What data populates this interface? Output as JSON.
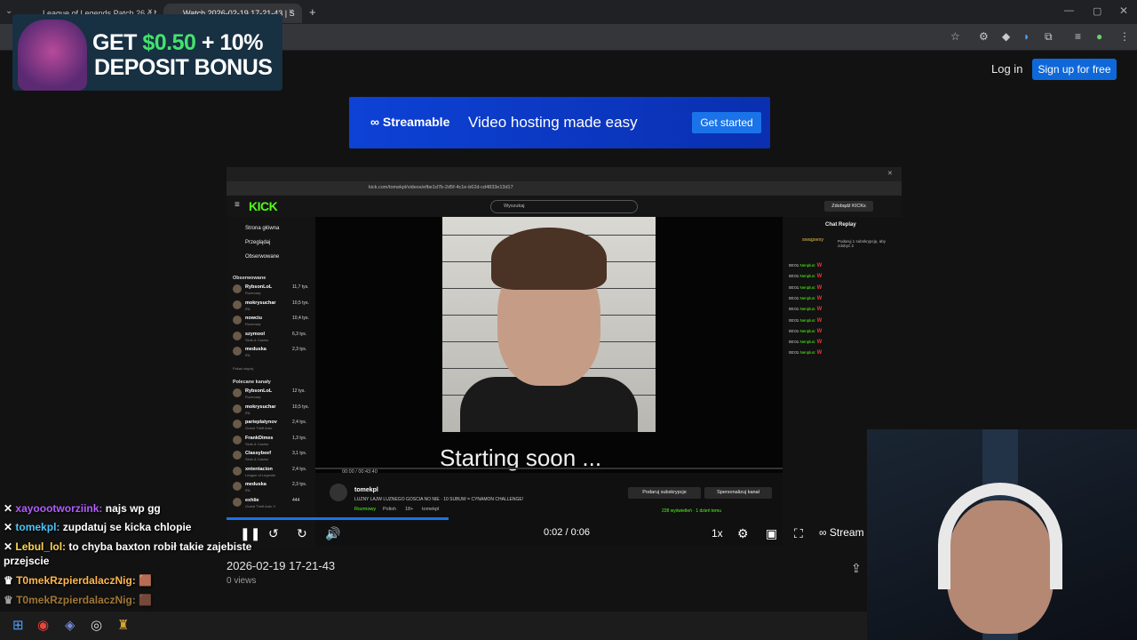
{
  "browser": {
    "tabs": [
      {
        "title": "League of Legends Patch 26.4 N",
        "active": false
      },
      {
        "title": "Watch 2026-02-19 17-21-43 | S",
        "active": true
      }
    ],
    "new_tab": "+",
    "tab_close": "×"
  },
  "ad": {
    "line1_prefix": "GET ",
    "line1_amount": "$0.50",
    "line1_suffix": " + 10%",
    "line2": "DEPOSIT BONUS"
  },
  "header": {
    "login": "Log in",
    "signup": "Sign up for free"
  },
  "promo": {
    "logo": "Streamable",
    "tagline": "Video hosting made easy",
    "cta": "Get started"
  },
  "video_frame": {
    "inner_url": "kick.com/tomekpl/videos/efbe1d7b-2d5f-4c1e-b62d-cd4833e13d17",
    "kick_logo": "KICK",
    "search_placeholder": "Wyszukaj",
    "get_kicks": "Zdobądź KICKs",
    "nav": [
      "Strona główna",
      "Przeglądaj",
      "Obserwowane"
    ],
    "followed_title": "Obserwowane",
    "followed": [
      {
        "name": "RybsonLoL",
        "sub": "Rozmowy",
        "count": "11,7 tys."
      },
      {
        "name": "mokrysuchar",
        "sub": "IRL",
        "count": "10,5 tys."
      },
      {
        "name": "nowciu",
        "sub": "Rozmowy",
        "count": "10,4 tys."
      },
      {
        "name": "szymool",
        "sub": "Slots & Casino",
        "count": "6,3 tys."
      },
      {
        "name": "meduska",
        "sub": "IRL",
        "count": "2,3 tys."
      }
    ],
    "show_more": "Pokaż więcej",
    "recommended_title": "Polecane kanały",
    "recommended": [
      {
        "name": "RybsonLoL",
        "sub": "Rozmowy",
        "count": "12 tys."
      },
      {
        "name": "mokrysuchar",
        "sub": "IRL",
        "count": "10,5 tys."
      },
      {
        "name": "parieplatynov",
        "sub": "Grand Theft Auto",
        "count": "2,4 tys."
      },
      {
        "name": "FrankDimes",
        "sub": "Slots & Casino",
        "count": "1,3 tys."
      },
      {
        "name": "Classybeef",
        "sub": "Slots & Casino",
        "count": "3,1 tys."
      },
      {
        "name": "xntentacion",
        "sub": "League of Legends",
        "count": "2,4 tys."
      },
      {
        "name": "meduska",
        "sub": "IRL",
        "count": "2,3 tys."
      },
      {
        "name": "exhlie",
        "sub": "Grand Theft Auto V",
        "count": "444"
      }
    ],
    "starting_text": "Starting soon ...",
    "inner_time": "00:00 / 00:43:40",
    "chat_title": "Chat Replay",
    "chat_sub_user": "swagsexy",
    "chat_sub_text": "Podaruj 1 subskrypcję, aby zdobyć 2",
    "chat_lines": [
      {
        "time": "00:01",
        "user": "Nenplus:",
        "msg": "W"
      },
      {
        "time": "00:01",
        "user": "Nenplus:",
        "msg": "W"
      },
      {
        "time": "00:01",
        "user": "Nenplus:",
        "msg": "W"
      },
      {
        "time": "00:01",
        "user": "Nenplus:",
        "msg": "W"
      },
      {
        "time": "00:01",
        "user": "Nenplus:",
        "msg": "W"
      },
      {
        "time": "00:01",
        "user": "Nenplus:",
        "msg": "W"
      },
      {
        "time": "00:01",
        "user": "Nenplus:",
        "msg": "W"
      },
      {
        "time": "00:01",
        "user": "Nenplus:",
        "msg": "W"
      },
      {
        "time": "00:01",
        "user": "Nenplus:",
        "msg": "W"
      }
    ],
    "streamer": "tomekpl",
    "stream_title": "LUZNY LAJW LUZNEGO GOSCIA NO NIE · 10 SUBUW = CYNAMON CHALLENGE!",
    "tags": [
      "Rozmowy",
      "Polish",
      "18+",
      "tomekpl"
    ],
    "sub_btn": "Podaruj subskrypcje",
    "pers_btn": "Spersonalizuj kanał",
    "inner_views": "228 wyświetleń · 1 dzień temu"
  },
  "player": {
    "time": "0:02 / 0:06",
    "speed": "1x",
    "brand": "Stream"
  },
  "video": {
    "title": "2026-02-19 17-21-43",
    "views": "0 views"
  },
  "overlay_chat": [
    {
      "user": "xayoootworziink:",
      "msg": " najs wp gg"
    },
    {
      "user": "tomekpl:",
      "msg": " zupdatuj se kicka chlopie"
    },
    {
      "user": "Lebul_lol:",
      "msg": " to chyba baxton robił takie zajebiste"
    },
    {
      "user": "",
      "msg": "przejscie"
    },
    {
      "user": "T0mekRzpierdalaczNig:",
      "msg": " 🟫"
    },
    {
      "user": "T0mekRzpierdalaczNig:",
      "msg": " 🟫"
    }
  ]
}
